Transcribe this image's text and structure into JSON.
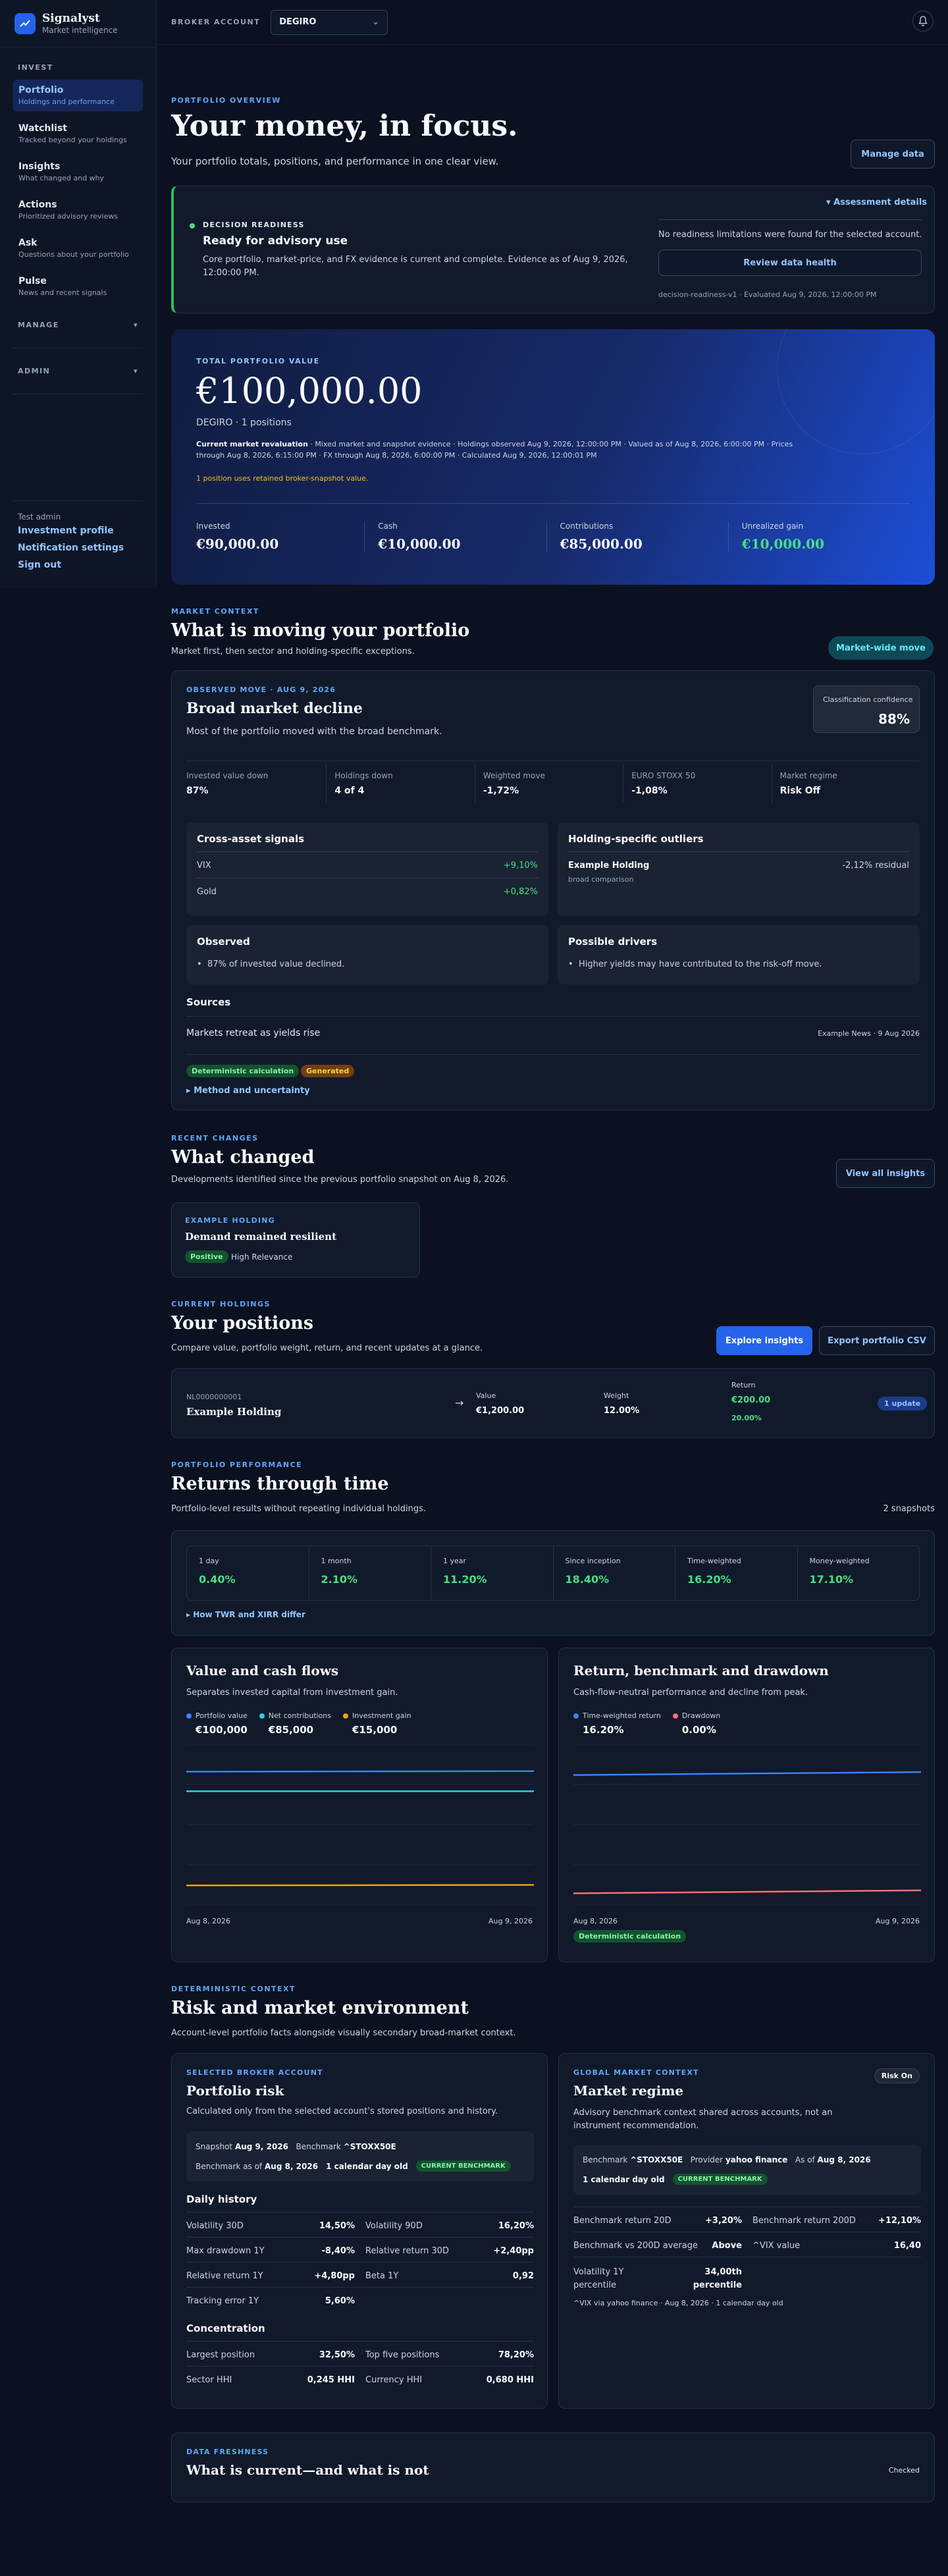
{
  "brand": {
    "name": "Signalyst",
    "tagline": "Market intelligence"
  },
  "sidebar": {
    "invest_heading": "INVEST",
    "items": [
      {
        "title": "Portfolio",
        "subtitle": "Holdings and performance"
      },
      {
        "title": "Watchlist",
        "subtitle": "Tracked beyond your holdings"
      },
      {
        "title": "Insights",
        "subtitle": "What changed and why"
      },
      {
        "title": "Actions",
        "subtitle": "Prioritized advisory reviews"
      },
      {
        "title": "Ask",
        "subtitle": "Questions about your portfolio"
      },
      {
        "title": "Pulse",
        "subtitle": "News and recent signals"
      }
    ],
    "manage_heading": "MANAGE",
    "admin_heading": "ADMIN",
    "user": "Test admin",
    "links": [
      "Investment profile",
      "Notification settings",
      "Sign out"
    ]
  },
  "topbar": {
    "broker_label": "BROKER ACCOUNT",
    "broker_value": "DEGIRO"
  },
  "overview": {
    "eyebrow": "PORTFOLIO OVERVIEW",
    "title": "Your money, in focus.",
    "subtitle": "Your portfolio totals, positions, and performance in one clear view.",
    "manage_button": "Manage data"
  },
  "readiness": {
    "label": "DECISION READINESS",
    "title": "Ready for advisory use",
    "text": "Core portfolio, market-price, and FX evidence is current and complete. Evidence as of Aug 9, 2026, 12:00:00 PM.",
    "details_link": "Assessment details",
    "limitations": "No readiness limitations were found for the selected account.",
    "review_button": "Review data health",
    "footer": "decision-readiness-v1 · Evaluated Aug 9, 2026, 12:00:00 PM"
  },
  "total": {
    "label": "TOTAL PORTFOLIO VALUE",
    "value": "€100,000.00",
    "account": "DEGIRO · 1 positions",
    "reval_bold": "Current market revaluation",
    "reval_text": " · Mixed market and snapshot evidence · Holdings observed Aug 9, 2026, 12:00:00 PM · Valued as of Aug 8, 2026, 6:00:00 PM · Prices through Aug 8, 2026, 6:15:00 PM · FX through Aug 8, 2026, 6:00:00 PM · Calculated Aug 9, 2026, 12:00:01 PM",
    "warning": "1 position uses retained broker-snapshot value.",
    "stats": [
      {
        "label": "Invested",
        "value": "€90,000.00"
      },
      {
        "label": "Cash",
        "value": "€10,000.00"
      },
      {
        "label": "Contributions",
        "value": "€85,000.00"
      },
      {
        "label": "Unrealized gain",
        "value": "€10,000.00"
      }
    ]
  },
  "market": {
    "eyebrow": "MARKET CONTEXT",
    "title": "What is moving your portfolio",
    "subtitle": "Market first, then sector and holding-specific exceptions.",
    "badge": "Market-wide move",
    "observed": "OBSERVED MOVE · AUG 9, 2026",
    "move_title": "Broad market decline",
    "move_text": "Most of the portfolio moved with the broad benchmark.",
    "confidence_label": "Classification confidence",
    "confidence_value": "88%",
    "stats": [
      {
        "label": "Invested value down",
        "value": "87%"
      },
      {
        "label": "Holdings down",
        "value": "4 of 4"
      },
      {
        "label": "Weighted move",
        "value": "-1,72%"
      },
      {
        "label": "EURO STOXX 50",
        "value": "-1,08%"
      },
      {
        "label": "Market regime",
        "value": "Risk Off"
      }
    ],
    "cross_title": "Cross-asset signals",
    "cross": [
      {
        "name": "VIX",
        "value": "+9,10%"
      },
      {
        "name": "Gold",
        "value": "+0,82%"
      }
    ],
    "outliers_title": "Holding-specific outliers",
    "outlier_name": "Example Holding",
    "outlier_value": "-2,12% residual",
    "outlier_sub": "broad comparison",
    "observed_title": "Observed",
    "observed_item": "87% of invested value declined.",
    "drivers_title": "Possible drivers",
    "drivers_item": "Higher yields may have contributed to the risk-off move.",
    "sources_title": "Sources",
    "source_headline": "Markets retreat as yields rise",
    "source_meta": "Example News · 9 Aug 2026",
    "tags": [
      "Deterministic calculation",
      "Generated"
    ],
    "method_link": "Method and uncertainty"
  },
  "changes": {
    "eyebrow": "RECENT CHANGES",
    "title": "What changed",
    "subtitle": "Developments identified since the previous portfolio snapshot on Aug 8, 2026.",
    "button": "View all insights",
    "card_eyebrow": "EXAMPLE HOLDING",
    "card_title": "Demand remained resilient",
    "card_tag": "Positive",
    "card_relevance": "High Relevance"
  },
  "holdings": {
    "eyebrow": "CURRENT HOLDINGS",
    "title": "Your positions",
    "subtitle": "Compare value, portfolio weight, return, and recent updates at a glance.",
    "explore_button": "Explore insights",
    "export_button": "Export portfolio CSV",
    "isin": "NL0000000001",
    "name": "Example Holding",
    "value_label": "Value",
    "value": "€1,200.00",
    "weight_label": "Weight",
    "weight": "12.00%",
    "return_label": "Return",
    "return_abs": "€200.00",
    "return_pct": "20.00%",
    "update_badge": "1 update"
  },
  "performance": {
    "eyebrow": "PORTFOLIO PERFORMANCE",
    "title": "Returns through time",
    "subtitle": "Portfolio-level results without repeating individual holdings.",
    "snapshots": "2 snapshots",
    "returns": [
      {
        "label": "1 day",
        "value": "0.40%"
      },
      {
        "label": "1 month",
        "value": "2.10%"
      },
      {
        "label": "1 year",
        "value": "11.20%"
      },
      {
        "label": "Since inception",
        "value": "18.40%"
      },
      {
        "label": "Time-weighted",
        "value": "16.20%"
      },
      {
        "label": "Money-weighted",
        "value": "17.10%"
      }
    ],
    "twr_link": "How TWR and XIRR differ"
  },
  "chart_data": [
    {
      "type": "line",
      "title": "Value and cash flows",
      "subtitle": "Separates invested capital from investment gain.",
      "x": [
        "Aug 8, 2026",
        "Aug 9, 2026"
      ],
      "series": [
        {
          "name": "Portfolio value",
          "display": "€100,000",
          "color": "#3b82f6",
          "values": [
            99600,
            100000
          ]
        },
        {
          "name": "Net contributions",
          "display": "€85,000",
          "color": "#22d3ee",
          "values": [
            85000,
            85000
          ]
        },
        {
          "name": "Investment gain",
          "display": "€15,000",
          "color": "#f59e0b",
          "values": [
            14600,
            15000
          ]
        }
      ],
      "ylim": [
        0,
        120000
      ]
    },
    {
      "type": "line",
      "title": "Return, benchmark and drawdown",
      "subtitle": "Cash-flow-neutral performance and decline from peak.",
      "x": [
        "Aug 8, 2026",
        "Aug 9, 2026"
      ],
      "series": [
        {
          "name": "Time-weighted return",
          "display": "16.20%",
          "color": "#3b82f6",
          "values": [
            15.8,
            16.2
          ]
        },
        {
          "name": "Drawdown",
          "display": "0.00%",
          "color": "#f87171",
          "values": [
            -0.4,
            0.0
          ]
        }
      ],
      "ylim": [
        -2,
        20
      ],
      "tag": "Deterministic calculation"
    }
  ],
  "risk": {
    "eyebrow": "DETERMINISTIC CONTEXT",
    "title": "Risk and market environment",
    "subtitle": "Account-level portfolio facts alongside visually secondary broad-market context.",
    "left": {
      "eyebrow": "SELECTED BROKER ACCOUNT",
      "title": "Portfolio risk",
      "text": "Calculated only from the selected account's stored positions and history.",
      "snapshot_label": "Snapshot",
      "snapshot": "Aug 9, 2026",
      "benchmark_label": "Benchmark",
      "benchmark": "^STOXX50E",
      "benchmark_asof_label": "Benchmark as of",
      "benchmark_asof": "Aug 8, 2026",
      "age": "1 calendar day old",
      "current_tag": "CURRENT BENCHMARK",
      "daily_title": "Daily history",
      "daily": [
        {
          "label": "Volatility 30D",
          "value": "14,50%"
        },
        {
          "label": "Volatility 90D",
          "value": "16,20%"
        },
        {
          "label": "Max drawdown 1Y",
          "value": "-8,40%"
        },
        {
          "label": "Relative return 30D",
          "value": "+2,40pp"
        },
        {
          "label": "Relative return 1Y",
          "value": "+4,80pp"
        },
        {
          "label": "Beta 1Y",
          "value": "0,92"
        },
        {
          "label": "Tracking error 1Y",
          "value": "5,60%"
        }
      ],
      "conc_title": "Concentration",
      "conc": [
        {
          "label": "Largest position",
          "value": "32,50%"
        },
        {
          "label": "Top five positions",
          "value": "78,20%"
        },
        {
          "label": "Sector HHI",
          "value": "0,245 HHI"
        },
        {
          "label": "Currency HHI",
          "value": "0,680 HHI"
        }
      ]
    },
    "right": {
      "eyebrow": "GLOBAL MARKET CONTEXT",
      "title": "Market regime",
      "badge": "Risk On",
      "text": "Advisory benchmark context shared across accounts, not an instrument recommendation.",
      "benchmark_label": "Benchmark",
      "benchmark": "^STOXX50E",
      "provider_label": "Provider",
      "provider": "yahoo finance",
      "asof_label": "As of",
      "asof": "Aug 8, 2026",
      "age": "1 calendar day old",
      "current_tag": "CURRENT BENCHMARK",
      "metrics": [
        {
          "label": "Benchmark return 20D",
          "value": "+3,20%"
        },
        {
          "label": "Benchmark return 200D",
          "value": "+12,10%"
        },
        {
          "label": "Benchmark vs 200D average",
          "value": "Above"
        },
        {
          "label": "^VIX value",
          "value": "16,40"
        },
        {
          "label": "Volatility 1Y percentile",
          "value": "34,00th percentile"
        }
      ],
      "footnote": "^VIX via yahoo finance · Aug 8, 2026 · 1 calendar day old"
    }
  },
  "freshness": {
    "eyebrow": "DATA FRESHNESS",
    "title": "What is current—and what is not",
    "status": "Checked"
  }
}
